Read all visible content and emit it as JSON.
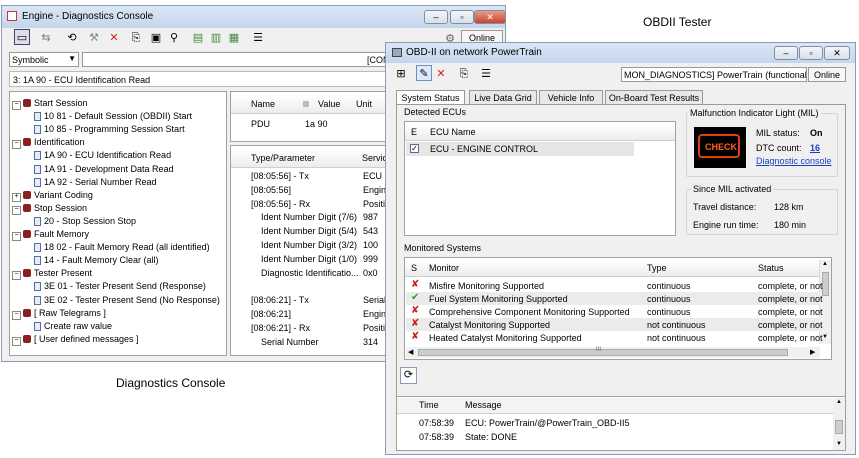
{
  "captions": {
    "left": "Diagnostics Console",
    "right": "OBDII Tester"
  },
  "console": {
    "title": "Engine - Diagnostics Console",
    "online_label": "Online",
    "mode_select": "Symbolic",
    "con_field": "[CON",
    "path": "3: 1A 90 - ECU Identification Read",
    "tree": [
      {
        "label": "Start Session",
        "type": "group"
      },
      {
        "label": "10 81 - Default Session (OBDII) Start",
        "type": "item"
      },
      {
        "label": "10 85 - Programming Session Start",
        "type": "item"
      },
      {
        "label": "Identification",
        "type": "group"
      },
      {
        "label": "1A 90 - ECU Identification Read",
        "type": "item"
      },
      {
        "label": "1A 91 - Development Data Read",
        "type": "item"
      },
      {
        "label": "1A 92 - Serial Number Read",
        "type": "item"
      },
      {
        "label": "Variant Coding",
        "type": "group"
      },
      {
        "label": "Stop Session",
        "type": "group"
      },
      {
        "label": "20 - Stop Session Stop",
        "type": "item"
      },
      {
        "label": "Fault Memory",
        "type": "group"
      },
      {
        "label": "18 02 - Fault Memory Read (all identified)",
        "type": "item"
      },
      {
        "label": "14 - Fault Memory Clear (all)",
        "type": "item"
      },
      {
        "label": "Tester Present",
        "type": "group"
      },
      {
        "label": "3E 01 - Tester Present Send (Response)",
        "type": "item"
      },
      {
        "label": "3E 02 - Tester Present Send (No Response)",
        "type": "item"
      },
      {
        "label": "[ Raw Telegrams ]",
        "type": "group"
      },
      {
        "label": "Create raw value",
        "type": "item"
      },
      {
        "label": "[ User defined messages ]",
        "type": "group"
      }
    ],
    "param_headers": {
      "name": "Name",
      "value": "Value",
      "unit": "Unit"
    },
    "param_row": {
      "name": "PDU",
      "value": "1a 90"
    },
    "trace_headers": {
      "type": "Type/Parameter",
      "service": "Servic"
    },
    "trace_rows": [
      {
        "type": "[08:05:56] - Tx",
        "service": "ECU I"
      },
      {
        "type": "[08:05:56]",
        "service": "Engine"
      },
      {
        "type": "[08:05:56] - Rx",
        "service": "Positiv"
      },
      {
        "type": "Ident Number Digit (7/6)",
        "service": "987"
      },
      {
        "type": "Ident Number Digit (5/4)",
        "service": "543"
      },
      {
        "type": "Ident Number Digit (3/2)",
        "service": "100"
      },
      {
        "type": "Ident Number Digit (1/0)",
        "service": "999"
      },
      {
        "type": "Diagnostic Identificatio...",
        "service": "0x0"
      },
      {
        "type": "",
        "service": ""
      },
      {
        "type": "[08:06:21] - Tx",
        "service": "Serial"
      },
      {
        "type": "[08:06:21]",
        "service": "Engine"
      },
      {
        "type": "[08:06:21] - Rx",
        "service": "Positiv"
      },
      {
        "type": "Serial Number",
        "service": "314"
      }
    ]
  },
  "obd": {
    "title": "OBD-II on network PowerTrain",
    "connection": "MON_DIAGNOSTICS] PowerTrain (functional)",
    "online_label": "Online",
    "tabs": [
      "System Status",
      "Live Data Grid",
      "Vehicle Info",
      "On-Board Test Results"
    ],
    "detected_ecus": {
      "title": "Detected ECUs",
      "col_e": "E",
      "col_name": "ECU Name",
      "row": "ECU - ENGINE CONTROL"
    },
    "mil": {
      "title": "Malfunction Indicator Light (MIL)",
      "lamp_text": "CHECK",
      "status_label": "MIL status:",
      "status_value": "On",
      "dtc_label": "DTC count:",
      "dtc_value": "16",
      "console_link": "Diagnostic console"
    },
    "since_mil": {
      "title": "Since MIL activated",
      "distance_label": "Travel distance:",
      "distance_value": "128 km",
      "runtime_label": "Engine run time:",
      "runtime_value": "180 min"
    },
    "monitored": {
      "title": "Monitored Systems",
      "headers": {
        "s": "S",
        "monitor": "Monitor",
        "type": "Type",
        "status": "Status"
      },
      "rows": [
        {
          "ok": false,
          "monitor": "Misfire Monitoring Supported",
          "type": "continuous",
          "status": "complete, or not"
        },
        {
          "ok": true,
          "monitor": "Fuel System Monitoring Supported",
          "type": "continuous",
          "status": "complete, or not"
        },
        {
          "ok": false,
          "monitor": "Comprehensive Component Monitoring Supported",
          "type": "continuous",
          "status": "complete, or not"
        },
        {
          "ok": false,
          "monitor": "Catalyst Monitoring Supported",
          "type": "not continuous",
          "status": "complete, or not"
        },
        {
          "ok": false,
          "monitor": "Heated Catalyst Monitoring Supported",
          "type": "not continuous",
          "status": "complete, or not"
        }
      ]
    },
    "log": {
      "headers": {
        "time": "Time",
        "message": "Message"
      },
      "rows": [
        {
          "time": "07:58:39",
          "message": "ECU: PowerTrain/@PowerTrain_OBD-II5"
        },
        {
          "time": "07:58:39",
          "message": "State: DONE"
        }
      ]
    }
  }
}
